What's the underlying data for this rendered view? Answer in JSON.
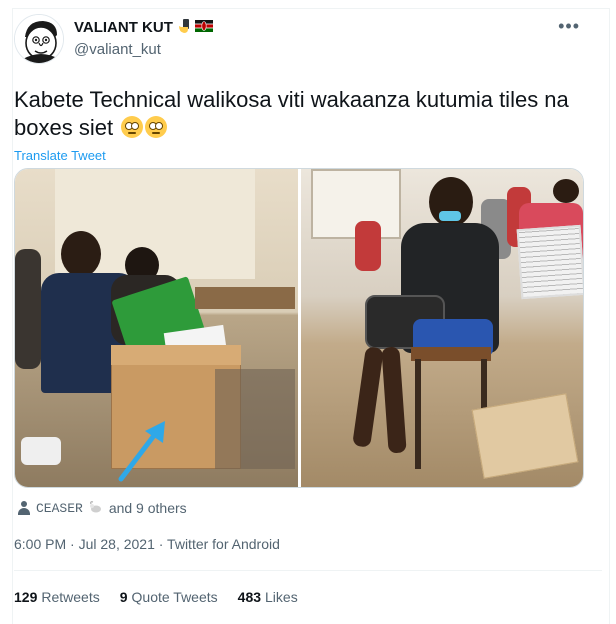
{
  "user": {
    "display_name": "VALIANT KUT",
    "handle": "@valiant_kut",
    "badges": [
      "hand-phone-emoji",
      "kenya-flag-emoji"
    ],
    "avatar_icon": "cartoon-face-avatar"
  },
  "tweet": {
    "text": "Kabete Technical walikosa viti wakaanza kutumia tiles na boxes siet",
    "emojis": [
      "face-with-rolling-eyes",
      "face-with-rolling-eyes"
    ],
    "translate_label": "Translate Tweet",
    "more_icon": "more-dots-icon"
  },
  "liked_by": {
    "name": "CEASER",
    "suffix": "and 9 others"
  },
  "meta": {
    "time": "6:00 PM",
    "date": "Jul 28, 2021",
    "source": "Twitter for Android",
    "line": "6:00 PM · Jul 28, 2021 · Twitter for Android"
  },
  "stats": {
    "retweets_count": "129",
    "retweets_label": "Retweets",
    "quotes_count": "9",
    "quotes_label": "Quote Tweets",
    "likes_count": "483",
    "likes_label": "Likes"
  },
  "colors": {
    "link": "#1d9bf0",
    "muted": "#536471",
    "text": "#0f1419"
  }
}
